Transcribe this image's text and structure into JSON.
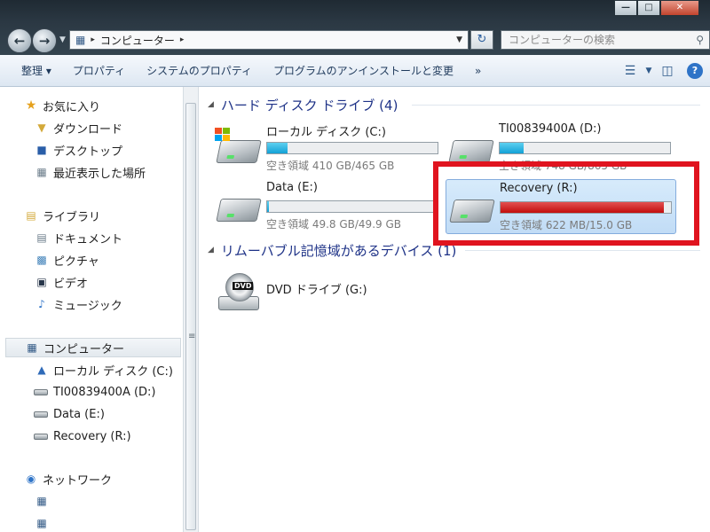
{
  "window": {
    "controls": [
      "—",
      "□",
      "✕"
    ]
  },
  "navigation": {
    "back_icon": "arrow-left-icon",
    "forward_icon": "arrow-right-icon"
  },
  "address_bar": {
    "location": "コンピューター",
    "separator": "▸"
  },
  "search": {
    "placeholder": "コンピューターの検索"
  },
  "toolbar": {
    "organize": "整理 ▾",
    "properties": "プロパティ",
    "system_properties": "システムのプロパティ",
    "uninstall": "プログラムのアンインストールと変更",
    "more": "»",
    "help": "?"
  },
  "sidebar": {
    "favorites": {
      "label": "お気に入り",
      "items": [
        {
          "label": "ダウンロード",
          "icon": "download-folder-icon"
        },
        {
          "label": "デスクトップ",
          "icon": "desktop-icon"
        },
        {
          "label": "最近表示した場所",
          "icon": "recent-places-icon"
        }
      ]
    },
    "libraries": {
      "label": "ライブラリ",
      "items": [
        {
          "label": "ドキュメント",
          "icon": "documents-icon"
        },
        {
          "label": "ピクチャ",
          "icon": "pictures-icon"
        },
        {
          "label": "ビデオ",
          "icon": "videos-icon"
        },
        {
          "label": "ミュージック",
          "icon": "music-icon"
        }
      ]
    },
    "computer": {
      "label": "コンピューター",
      "items": [
        {
          "label": "ローカル ディスク (C:)",
          "icon": "system-drive-icon"
        },
        {
          "label": "TI00839400A (D:)",
          "icon": "drive-icon"
        },
        {
          "label": "Data (E:)",
          "icon": "drive-icon"
        },
        {
          "label": "Recovery (R:)",
          "icon": "drive-icon"
        }
      ]
    },
    "network": {
      "label": "ネットワーク"
    }
  },
  "content": {
    "hard_disks_header": "ハード ディスク ドライブ (4)",
    "removable_header": "リムーバブル記憶域があるデバイス (1)",
    "drives": [
      {
        "name": "ローカル ディスク (C:)",
        "free": "空き領域 410 GB/465 GB",
        "used_fraction": 0.12,
        "status": "normal"
      },
      {
        "name": "TI00839400A (D:)",
        "free": "空き領域 748 GB/865 GB",
        "used_fraction": 0.14,
        "status": "normal"
      },
      {
        "name": "Data (E:)",
        "free": "空き領域 49.8 GB/49.9 GB",
        "used_fraction": 0.01,
        "status": "normal"
      },
      {
        "name": "Recovery (R:)",
        "free": "空き領域 622 MB/15.0 GB",
        "used_fraction": 0.96,
        "status": "critical"
      }
    ],
    "removable": [
      {
        "name": "DVD ドライブ (G:)",
        "label": "DVD"
      }
    ]
  },
  "colors": {
    "bar_normal": "#13a1d6",
    "bar_critical": "#c20d0d",
    "highlight": "#e0141f",
    "group_header": "#1e3287"
  }
}
